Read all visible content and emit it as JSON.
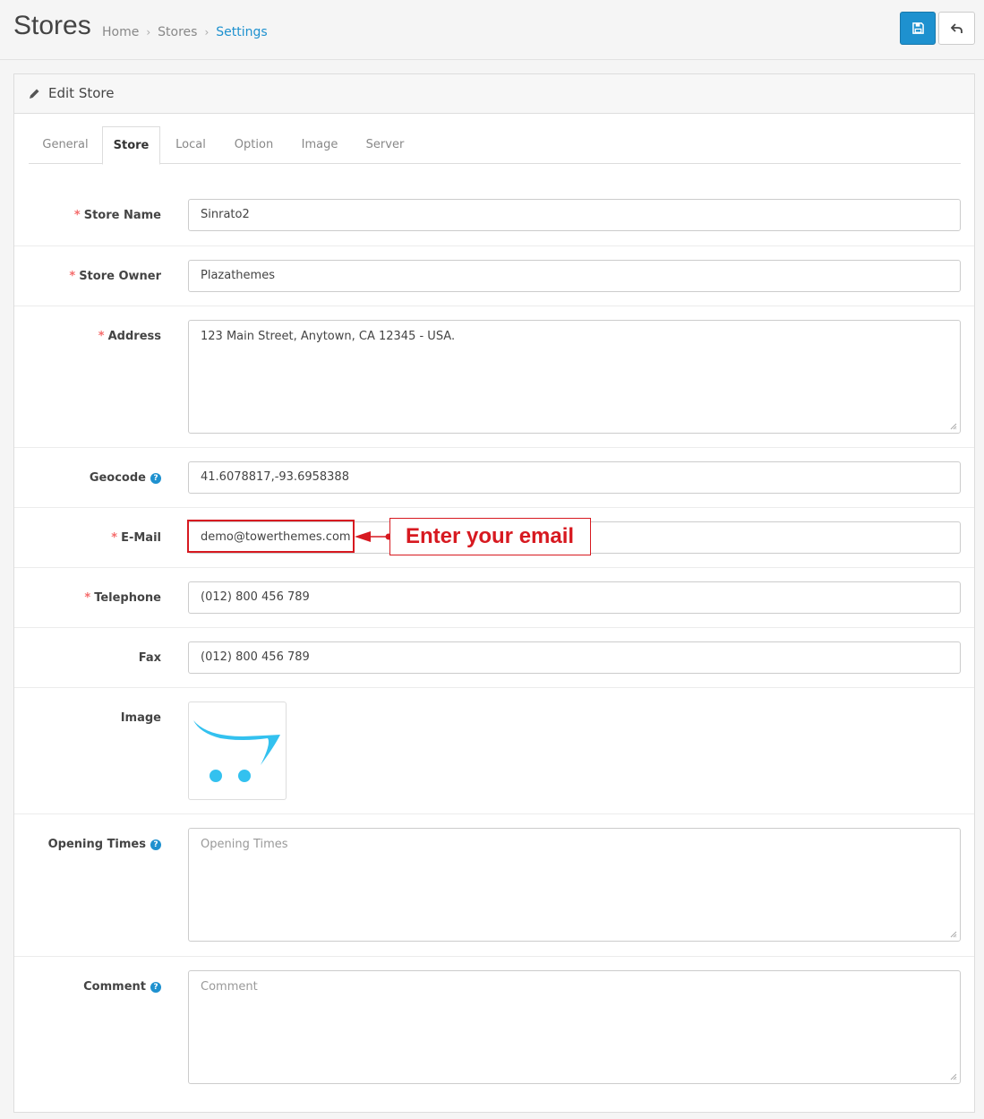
{
  "header": {
    "title": "Stores",
    "breadcrumb": [
      "Home",
      "Stores",
      "Settings"
    ]
  },
  "panel": {
    "title": "Edit Store"
  },
  "tabs": [
    "General",
    "Store",
    "Local",
    "Option",
    "Image",
    "Server"
  ],
  "active_tab": "Store",
  "form": {
    "store_name": {
      "label": "Store Name",
      "value": "Sinrato2"
    },
    "store_owner": {
      "label": "Store Owner",
      "value": "Plazathemes"
    },
    "address": {
      "label": "Address",
      "value": "123 Main Street, Anytown, CA 12345 - USA."
    },
    "geocode": {
      "label": "Geocode",
      "value": "41.6078817,-93.6958388"
    },
    "email": {
      "label": "E-Mail",
      "value": "demo@towerthemes.com"
    },
    "telephone": {
      "label": "Telephone",
      "value": "(012) 800 456 789"
    },
    "fax": {
      "label": "Fax",
      "value": "(012) 800 456 789"
    },
    "image": {
      "label": "Image"
    },
    "opening_times": {
      "label": "Opening Times",
      "placeholder": "Opening Times"
    },
    "comment": {
      "label": "Comment",
      "placeholder": "Comment"
    }
  },
  "annotation": {
    "text": "Enter your email"
  },
  "colors": {
    "primary": "#1e91cf",
    "required": "#f56b6b",
    "annotation": "#d71920",
    "cart_logo": "#33c1ef"
  },
  "icons": {
    "save": "floppy-disk-icon",
    "back": "reply-icon",
    "edit": "pencil-icon",
    "help": "question-circle-icon"
  }
}
